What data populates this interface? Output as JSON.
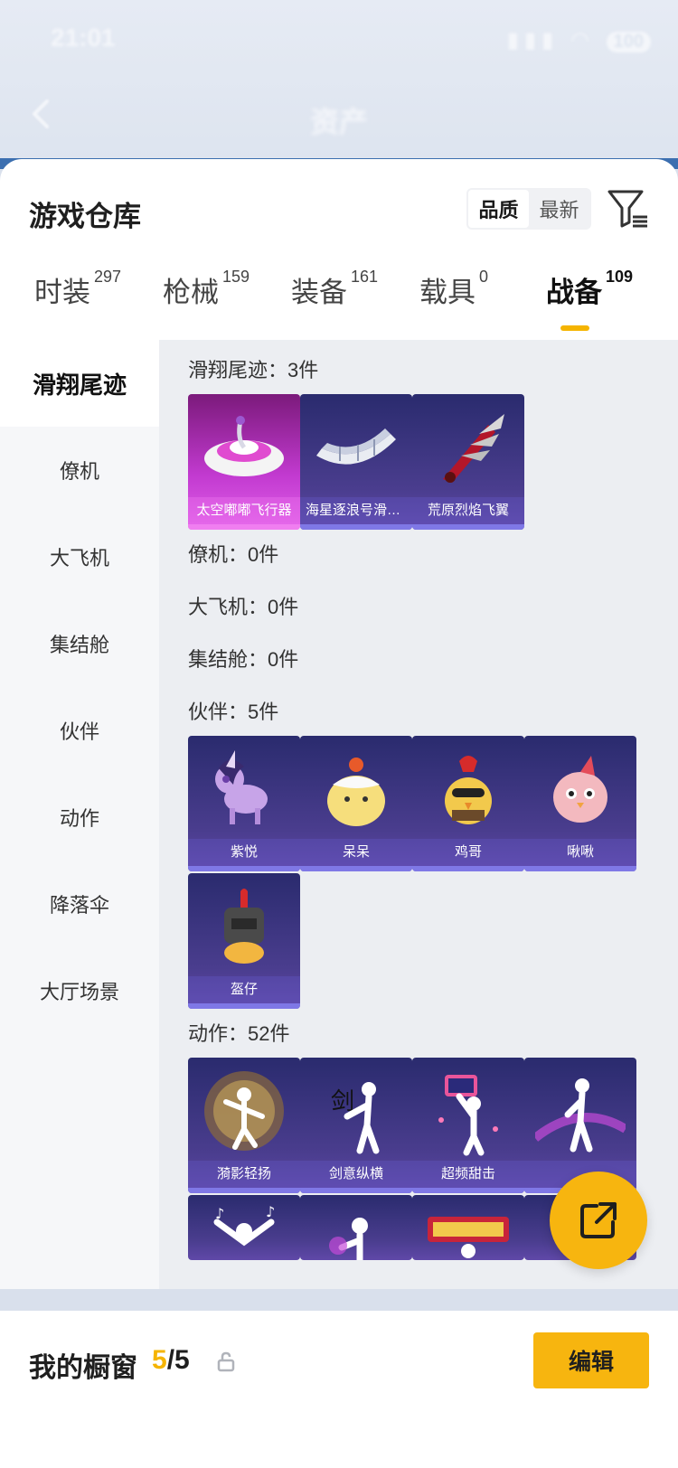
{
  "status_bar": {
    "time": "21:01",
    "battery": "100"
  },
  "nav": {
    "title": "资产"
  },
  "warehouse": {
    "title": "游戏仓库",
    "sort_options": [
      "品质",
      "最新"
    ],
    "active_sort": "品质"
  },
  "tabs": [
    {
      "label": "时装",
      "count": "297"
    },
    {
      "label": "枪械",
      "count": "159"
    },
    {
      "label": "装备",
      "count": "161"
    },
    {
      "label": "载具",
      "count": "0"
    },
    {
      "label": "战备",
      "count": "109"
    }
  ],
  "active_tab": "战备",
  "sidebar": {
    "items": [
      "滑翔尾迹",
      "僚机",
      "大飞机",
      "集结舱",
      "伙伴",
      "动作",
      "降落伞",
      "大厅场景"
    ],
    "active": "滑翔尾迹"
  },
  "sections": {
    "glide_trail": {
      "title": "滑翔尾迹：3件",
      "items": [
        "太空嘟嘟飞行器",
        "海星逐浪号滑翔器",
        "荒原烈焰飞翼"
      ]
    },
    "wingman": {
      "title": "僚机：0件"
    },
    "big_plane": {
      "title": "大飞机：0件"
    },
    "pod": {
      "title": "集结舱：0件"
    },
    "partner": {
      "title": "伙伴：5件",
      "items": [
        "紫悦",
        "呆呆",
        "鸡哥",
        "啾啾",
        "盔仔"
      ]
    },
    "emote": {
      "title": "动作：52件",
      "items": [
        "漪影轻扬",
        "剑意纵横",
        "超频甜击",
        ""
      ]
    }
  },
  "showcase": {
    "label": "我的橱窗",
    "current": "5",
    "total": "/5",
    "edit_label": "编辑"
  },
  "colors": {
    "accent": "#f7b50f",
    "tile_bg": "#3b3580",
    "tile_pink": "#c23ad0"
  }
}
